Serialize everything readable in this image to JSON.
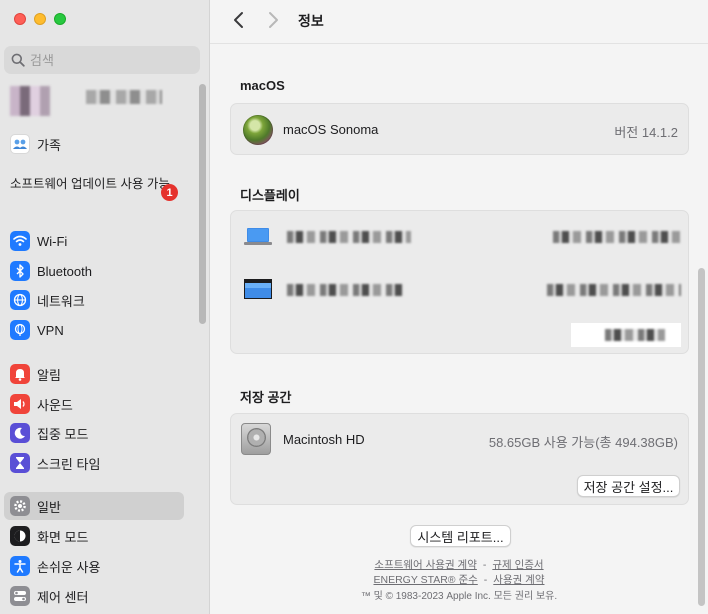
{
  "sidebar": {
    "search_placeholder": "검색",
    "family_label": "가족",
    "update_label": "소프트웨어 업데이트 사용 가능",
    "update_badge": "1",
    "groups": [
      [
        {
          "label": "Wi-Fi",
          "icon": "wifi-icon",
          "color": "#1f7aff"
        },
        {
          "label": "Bluetooth",
          "icon": "bluetooth-icon",
          "color": "#1f7aff"
        },
        {
          "label": "네트워크",
          "icon": "globe-icon",
          "color": "#1f7aff"
        },
        {
          "label": "VPN",
          "icon": "vpn-globe-icon",
          "color": "#1f7aff"
        }
      ],
      [
        {
          "label": "알림",
          "icon": "bell-icon",
          "color": "#f0443a"
        },
        {
          "label": "사운드",
          "icon": "speaker-icon",
          "color": "#f0443a"
        },
        {
          "label": "집중 모드",
          "icon": "moon-icon",
          "color": "#5a4fd6"
        },
        {
          "label": "스크린 타임",
          "icon": "hourglass-icon",
          "color": "#5a4fd6"
        }
      ],
      [
        {
          "label": "일반",
          "icon": "gear-icon",
          "color": "#8e8e93",
          "selected": true
        },
        {
          "label": "화면 모드",
          "icon": "appearance-icon",
          "color": "#1d1d1f"
        },
        {
          "label": "손쉬운 사용",
          "icon": "accessibility-icon",
          "color": "#1f7aff"
        },
        {
          "label": "제어 센터",
          "icon": "control-center-icon",
          "color": "#8e8e93"
        }
      ]
    ]
  },
  "toolbar": {
    "title": "정보"
  },
  "macos": {
    "section_title": "macOS",
    "name": "macOS Sonoma",
    "version": "버전 14.1.2"
  },
  "displays": {
    "section_title": "디스플레이"
  },
  "storage": {
    "section_title": "저장 공간",
    "disk_name": "Macintosh HD",
    "disk_info": "58.65GB 사용 가능(총 494.38GB)",
    "settings_button": "저장 공간 설정..."
  },
  "footer": {
    "report_button": "시스템 리포트...",
    "link_license": "소프트웨어 사용권 계약",
    "link_regulatory": "규제 인증서",
    "link_energy": "ENERGY STAR® 준수",
    "link_terms": "사용권 계약",
    "sep": "-",
    "copyright": "™ 및 © 1983-2023 Apple Inc. 모든 권리 보유."
  }
}
